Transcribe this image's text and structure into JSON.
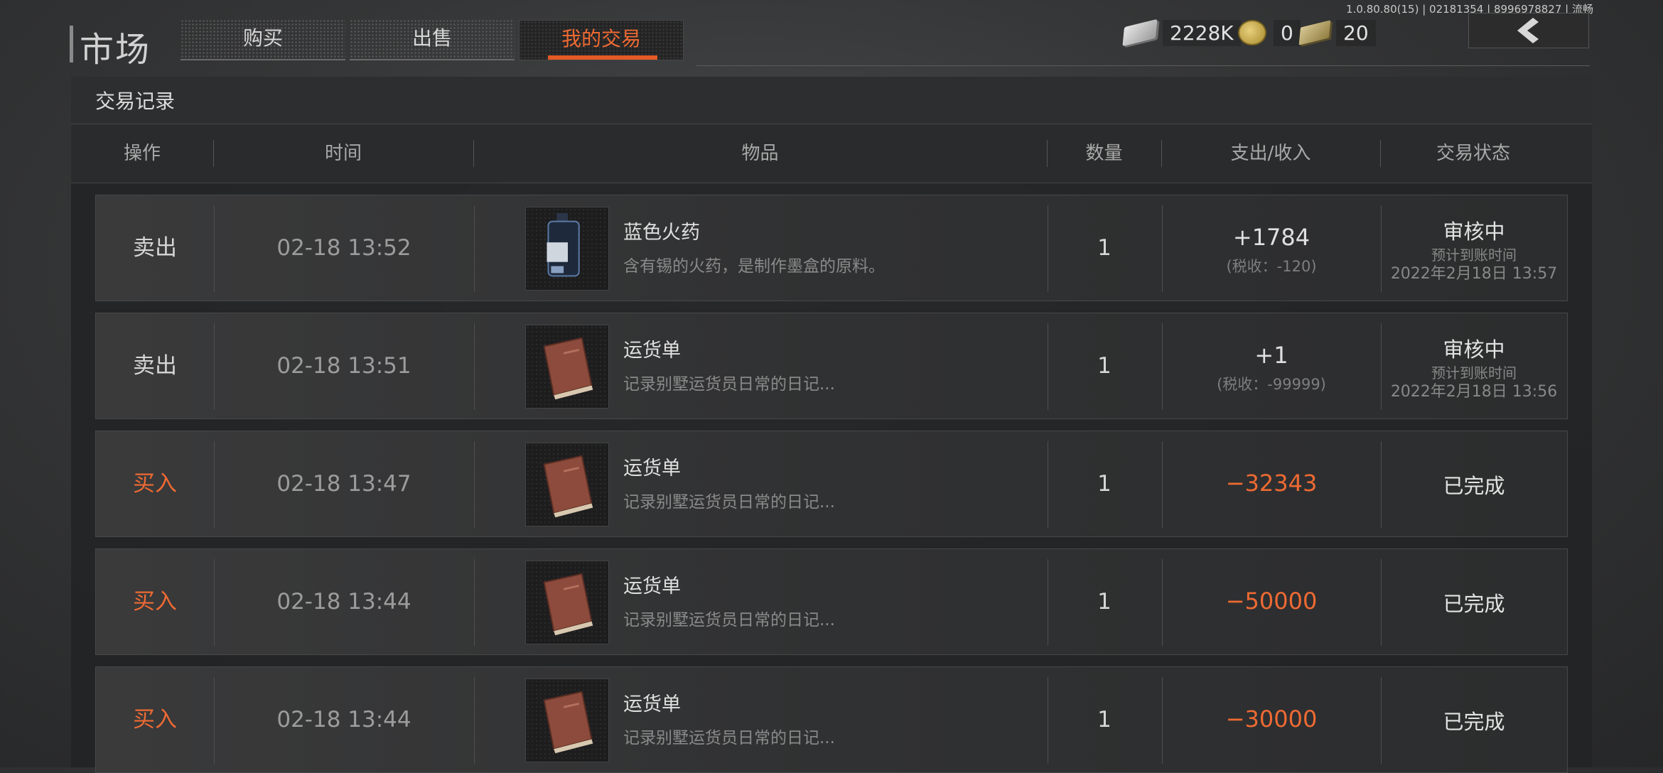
{
  "version": "1.0.80.80(15) | 02181354 | 8996978827 | 流畅",
  "header": {
    "title": "市场",
    "tabs": [
      {
        "label": "购买",
        "active": false
      },
      {
        "label": "出售",
        "active": false
      },
      {
        "label": "我的交易",
        "active": true
      }
    ]
  },
  "currencies": [
    {
      "icon": "cash-icon",
      "value": "2228K"
    },
    {
      "icon": "coin-icon",
      "value": "0"
    },
    {
      "icon": "bill-icon",
      "value": "20"
    }
  ],
  "panel": {
    "title": "交易记录",
    "columns": [
      "操作",
      "时间",
      "物品",
      "数量",
      "支出/收入",
      "交易状态"
    ]
  },
  "colors": {
    "accent": "#ee6a33",
    "text": "#e0e0e0",
    "muted": "#8a8a8a"
  },
  "rows": [
    {
      "action": "卖出",
      "type": "sell",
      "time": "02-18 13:52",
      "item_icon": "gunpowder-icon",
      "item_name": "蓝色火药",
      "item_desc": "含有锡的火药，是制作墨盒的原料。",
      "qty": "1",
      "amount": "+1784",
      "tax": "(税收：-120)",
      "status": "审核中",
      "status_sub1": "预计到账时间",
      "status_sub2": "2022年2月18日 13:57"
    },
    {
      "action": "卖出",
      "type": "sell",
      "time": "02-18 13:51",
      "item_icon": "book-icon",
      "item_name": "运货单",
      "item_desc": "记录别墅运货员日常的日记...",
      "qty": "1",
      "amount": "+1",
      "tax": "(税收：-99999)",
      "status": "审核中",
      "status_sub1": "预计到账时间",
      "status_sub2": "2022年2月18日 13:56"
    },
    {
      "action": "买入",
      "type": "buy",
      "time": "02-18 13:47",
      "item_icon": "book-icon",
      "item_name": "运货单",
      "item_desc": "记录别墅运货员日常的日记...",
      "qty": "1",
      "amount": "−32343",
      "tax": "",
      "status": "已完成",
      "status_sub1": "",
      "status_sub2": ""
    },
    {
      "action": "买入",
      "type": "buy",
      "time": "02-18 13:44",
      "item_icon": "book-icon",
      "item_name": "运货单",
      "item_desc": "记录别墅运货员日常的日记...",
      "qty": "1",
      "amount": "−50000",
      "tax": "",
      "status": "已完成",
      "status_sub1": "",
      "status_sub2": ""
    },
    {
      "action": "买入",
      "type": "buy",
      "time": "02-18 13:44",
      "item_icon": "book-icon",
      "item_name": "运货单",
      "item_desc": "记录别墅运货员日常的日记...",
      "qty": "1",
      "amount": "−30000",
      "tax": "",
      "status": "已完成",
      "status_sub1": "",
      "status_sub2": ""
    }
  ]
}
